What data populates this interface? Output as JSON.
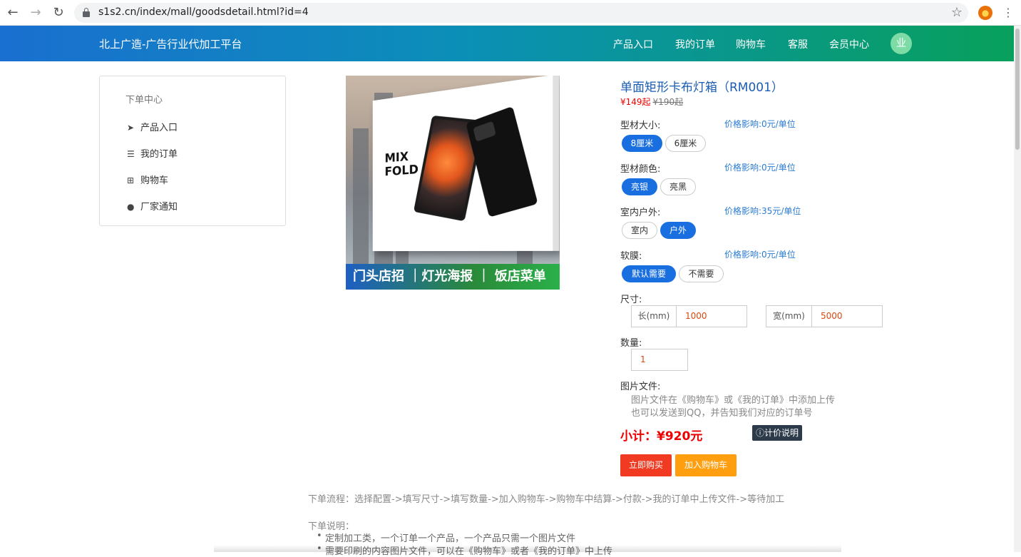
{
  "browser": {
    "url": "s1s2.cn/index/mall/goodsdetail.html?id=4",
    "back_icon": "←",
    "forward_icon": "→",
    "reload_icon": "↻",
    "star_icon": "☆",
    "menu_icon": "⋮"
  },
  "header": {
    "brand": "北上广造-广告行业代加工平台",
    "nav": [
      "产品入口",
      "我的订单",
      "购物车",
      "客服",
      "会员中心"
    ],
    "avatar_text": "业"
  },
  "sidebar": {
    "title": "下单中心",
    "items": [
      {
        "icon": "paper-plane-icon",
        "glyph": "➤",
        "label": "产品入口"
      },
      {
        "icon": "list-icon",
        "glyph": "☰",
        "label": "我的订单"
      },
      {
        "icon": "cart-icon",
        "glyph": "⊞",
        "label": "购物车"
      },
      {
        "icon": "comment-icon",
        "glyph": "●",
        "label": "厂家通知"
      }
    ]
  },
  "image": {
    "mix_line1": "MIX",
    "mix_line2": "FOLD",
    "banner": "门头店招 ｜灯光海报 ｜ 饭店菜单"
  },
  "product": {
    "title": "单面矩形卡布灯箱（RM001）",
    "price": "¥149起",
    "old_price": "¥190起",
    "options": [
      {
        "label": "型材大小:",
        "hint": "价格影响:0元/单位",
        "choices": [
          "8厘米",
          "6厘米"
        ],
        "selected": "8厘米"
      },
      {
        "label": "型材颜色:",
        "hint": "价格影响:0元/单位",
        "choices": [
          "亮银",
          "亮黑"
        ],
        "selected": "亮银"
      },
      {
        "label": "室内户外:",
        "hint": "价格影响:35元/单位",
        "choices": [
          "室内",
          "户外"
        ],
        "selected": "户外"
      },
      {
        "label": "软膜:",
        "hint": "价格影响:0元/单位",
        "choices": [
          "默认需要",
          "不需要"
        ],
        "selected": "默认需要"
      }
    ],
    "size_label": "尺寸:",
    "length_label": "长(mm)",
    "length_value": "1000",
    "width_label": "宽(mm)",
    "width_value": "5000",
    "qty_label": "数量:",
    "qty_value": "1",
    "file_label": "图片文件:",
    "file_note1": "图片文件在《购物车》或《我的订单》中添加上传",
    "file_note2": "也可以发送到QQ，并告知我们对应的订单号",
    "subtotal": "小计：¥920元",
    "price_help": "计价说明",
    "buy_now": "立即购买",
    "add_cart": "加入购物车"
  },
  "footer": {
    "flow": "下单流程：选择配置->填写尺寸->填写数量->加入购物车->购物车中结算->付款->我的订单中上传文件->等待加工",
    "notes_title": "下单说明：",
    "notes": [
      "定制加工类，一个订单一个产品，一个产品只需一个图片文件",
      "需要印刷的内容图片文件，可以在《购物车》或者《我的订单》中上传"
    ]
  }
}
